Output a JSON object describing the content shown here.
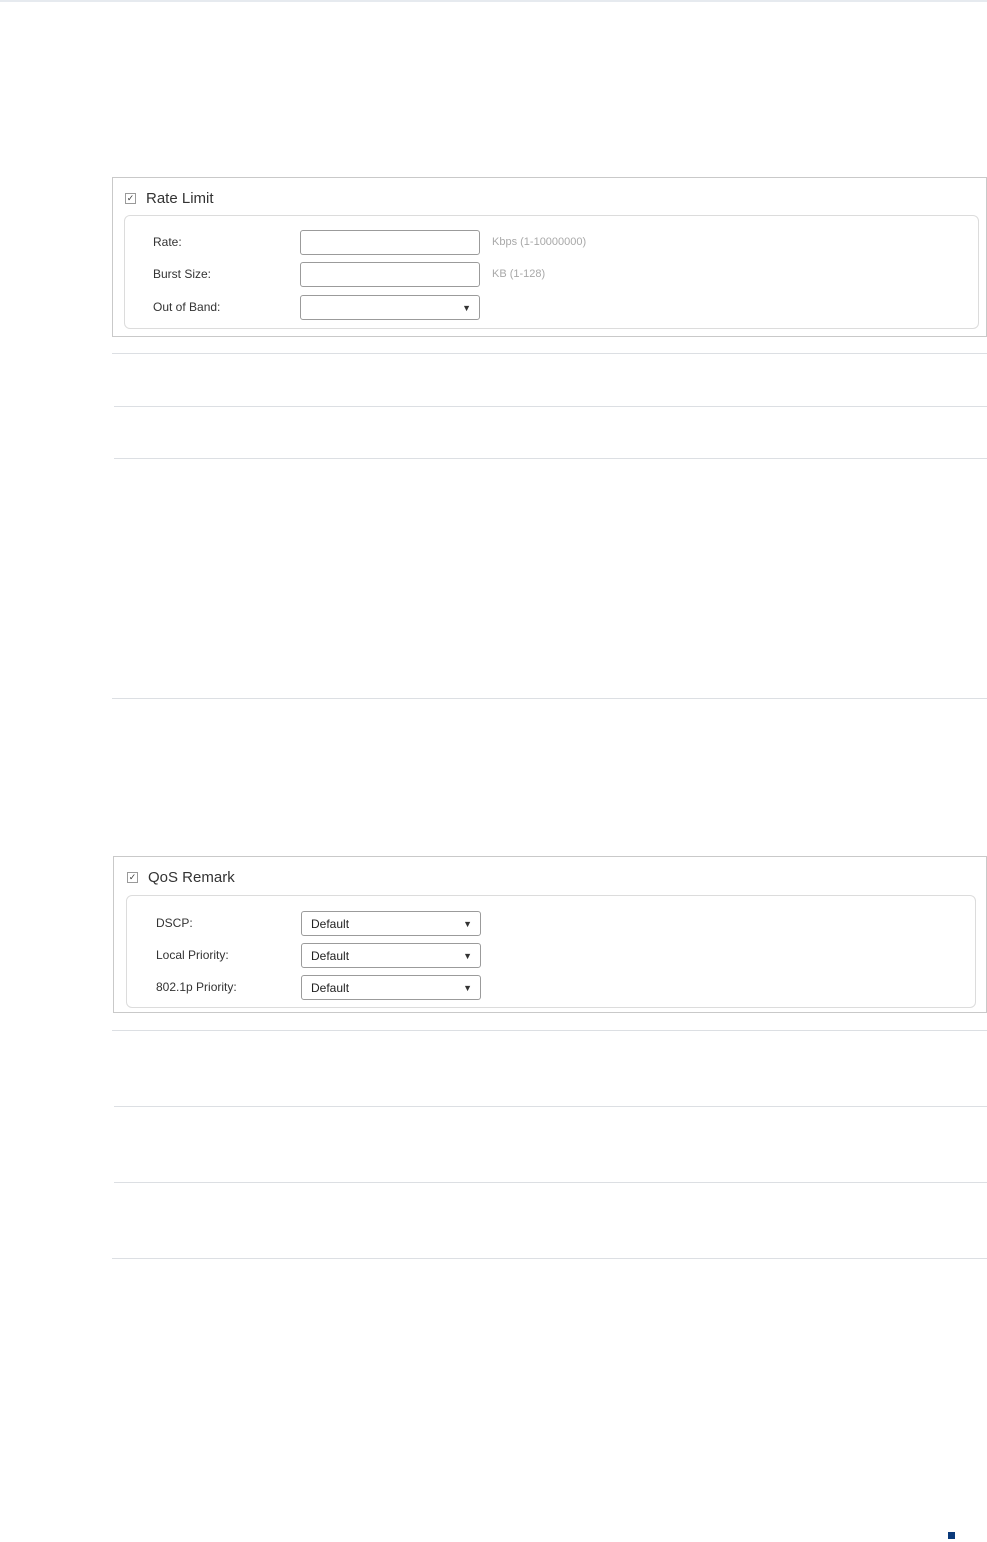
{
  "rate_limit": {
    "title": "Rate Limit",
    "checked_mark": "✓",
    "rows": [
      {
        "label": "Rate:",
        "value": "",
        "hint": "Kbps (1-10000000)"
      },
      {
        "label": "Burst Size:",
        "value": "",
        "hint": "KB (1-128)"
      },
      {
        "label": "Out of Band:",
        "value": ""
      }
    ]
  },
  "qos_remark": {
    "title": "QoS Remark",
    "checked_mark": "✓",
    "rows": [
      {
        "label": "DSCP:",
        "value": "Default"
      },
      {
        "label": "Local Priority:",
        "value": "Default"
      },
      {
        "label": "802.1p Priority:",
        "value": "Default"
      }
    ]
  },
  "icons": {
    "dropdown": "▼"
  },
  "colors": {
    "page_marker": "#0b3a7a",
    "border": "#c9c9c9",
    "hint": "#a8a8a8"
  }
}
